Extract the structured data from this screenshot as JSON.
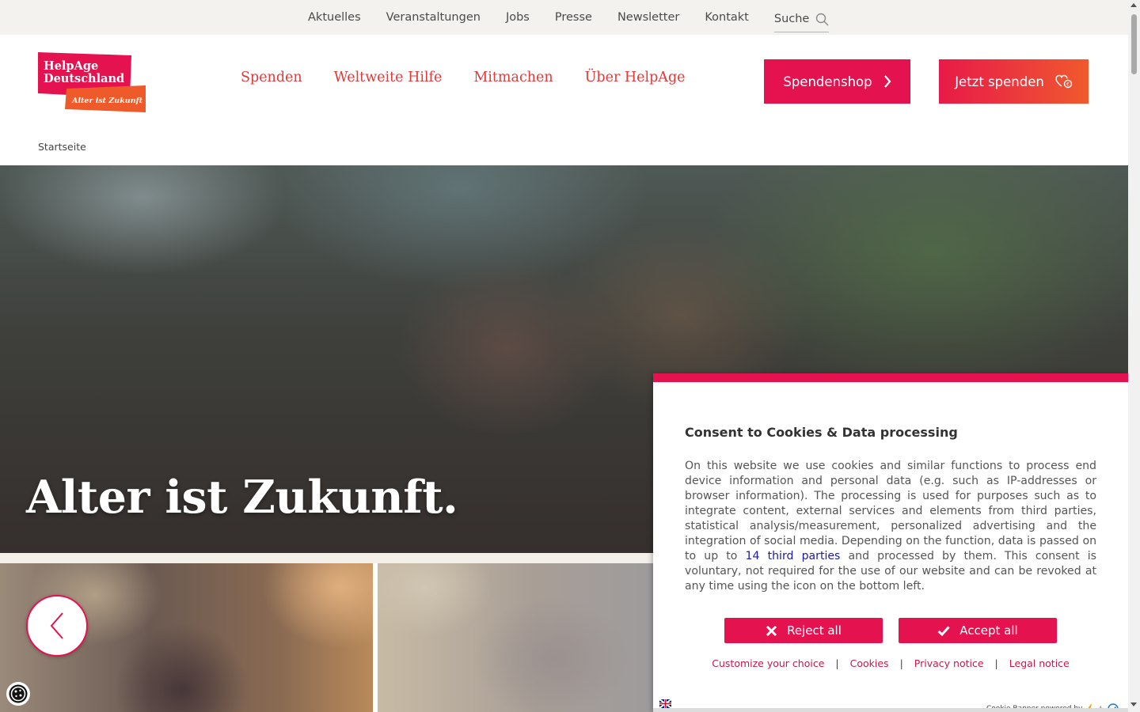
{
  "topnav": {
    "items": [
      "Aktuelles",
      "Veranstaltungen",
      "Jobs",
      "Presse",
      "Newsletter",
      "Kontakt"
    ],
    "search_label": "Suche"
  },
  "logo": {
    "line1": "HelpAge",
    "line2": "Deutschland",
    "tagline": "Alter ist Zukunft"
  },
  "mainnav": {
    "items": [
      "Spenden",
      "Weltweite Hilfe",
      "Mitmachen",
      "Über HelpAge"
    ]
  },
  "header": {
    "shop_label": "Spendenshop",
    "donate_label": "Jetzt spenden"
  },
  "breadcrumb": {
    "home": "Startseite"
  },
  "hero": {
    "title": "Alter ist Zukunft."
  },
  "consent": {
    "title": "Consent to Cookies & Data processing",
    "text_before": "On this website we use cookies and similar functions to process end device information and personal data (e.g. such as IP-addresses or browser information). The processing is used for purposes such as to integrate content, external services and elements from third parties, statistical analysis/measurement, personalized advertising and the integration of social media. Depending on the function, data is passed on to up to ",
    "third_parties_link": "14 third parties",
    "text_after": " and processed by them. This consent is voluntary, not required for the use of our website and can be revoked at any time using the icon on the bottom left.",
    "reject_label": "Reject all",
    "accept_label": "Accept all",
    "links": [
      "Customize your choice",
      "Cookies",
      "Privacy notice",
      "Legal notice"
    ],
    "powered_by": "Cookie Banner powered by",
    "powered_plus": "+"
  },
  "colors": {
    "brand_red": "#e4134f",
    "nav_red": "#e03a3a",
    "donate_gradient_end": "#f0592d",
    "link_blue": "#1a1aa6"
  },
  "icons": [
    "search-icon",
    "chevron-right-icon",
    "heart-hand-icon",
    "chevron-left-icon",
    "cookie-icon",
    "close-icon",
    "check-icon",
    "flag-icon"
  ]
}
